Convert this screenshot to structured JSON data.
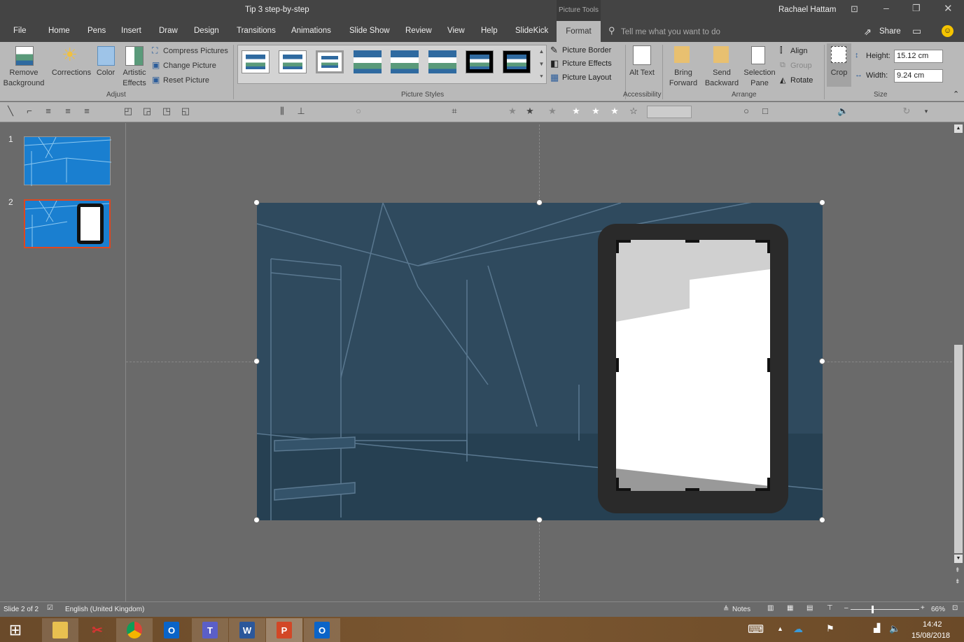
{
  "window": {
    "title": "Tip 3 step-by-step",
    "context_tab_group": "Picture Tools",
    "user": "Rachael Hattam"
  },
  "tabs": [
    "File",
    "Home",
    "Pens",
    "Insert",
    "Draw",
    "Design",
    "Transitions",
    "Animations",
    "Slide Show",
    "Review",
    "View",
    "Help",
    "SlideKick",
    "Format"
  ],
  "active_tab": "Format",
  "tell_me": {
    "placeholder": "Tell me what you want to do"
  },
  "share_label": "Share",
  "ribbon": {
    "adjust": {
      "label": "Adjust",
      "remove_background": "Remove Background",
      "corrections": "Corrections",
      "color": "Color",
      "artistic_effects": "Artistic Effects",
      "compress": "Compress Pictures",
      "change": "Change Picture",
      "reset": "Reset Picture"
    },
    "picture_styles": {
      "label": "Picture Styles",
      "border": "Picture Border",
      "effects": "Picture Effects",
      "layout": "Picture Layout"
    },
    "accessibility": {
      "label": "Accessibility",
      "alt_text": "Alt Text"
    },
    "arrange": {
      "label": "Arrange",
      "bring_forward": "Bring Forward",
      "send_backward": "Send Backward",
      "selection_pane": "Selection Pane",
      "align": "Align",
      "group": "Group",
      "rotate": "Rotate"
    },
    "size": {
      "label": "Size",
      "crop": "Crop",
      "height_label": "Height:",
      "height_value": "15.12 cm",
      "width_label": "Width:",
      "width_value": "9.24 cm"
    }
  },
  "slides": [
    {
      "number": "1"
    },
    {
      "number": "2",
      "selected": true
    }
  ],
  "status": {
    "slide": "Slide 2 of 2",
    "language": "English (United Kingdom)",
    "notes": "Notes",
    "zoom": "66%",
    "zoom_percent": 66
  },
  "taskbar": {
    "apps": [
      "file-explorer",
      "snipping-tool",
      "chrome",
      "outlook",
      "teams",
      "word",
      "powerpoint",
      "outlook"
    ],
    "time": "14:42",
    "date": "15/08/2018"
  },
  "colors": {
    "accent": "#d24726",
    "selection": "#e0461f",
    "slide_bg": "#2f4a5e"
  }
}
